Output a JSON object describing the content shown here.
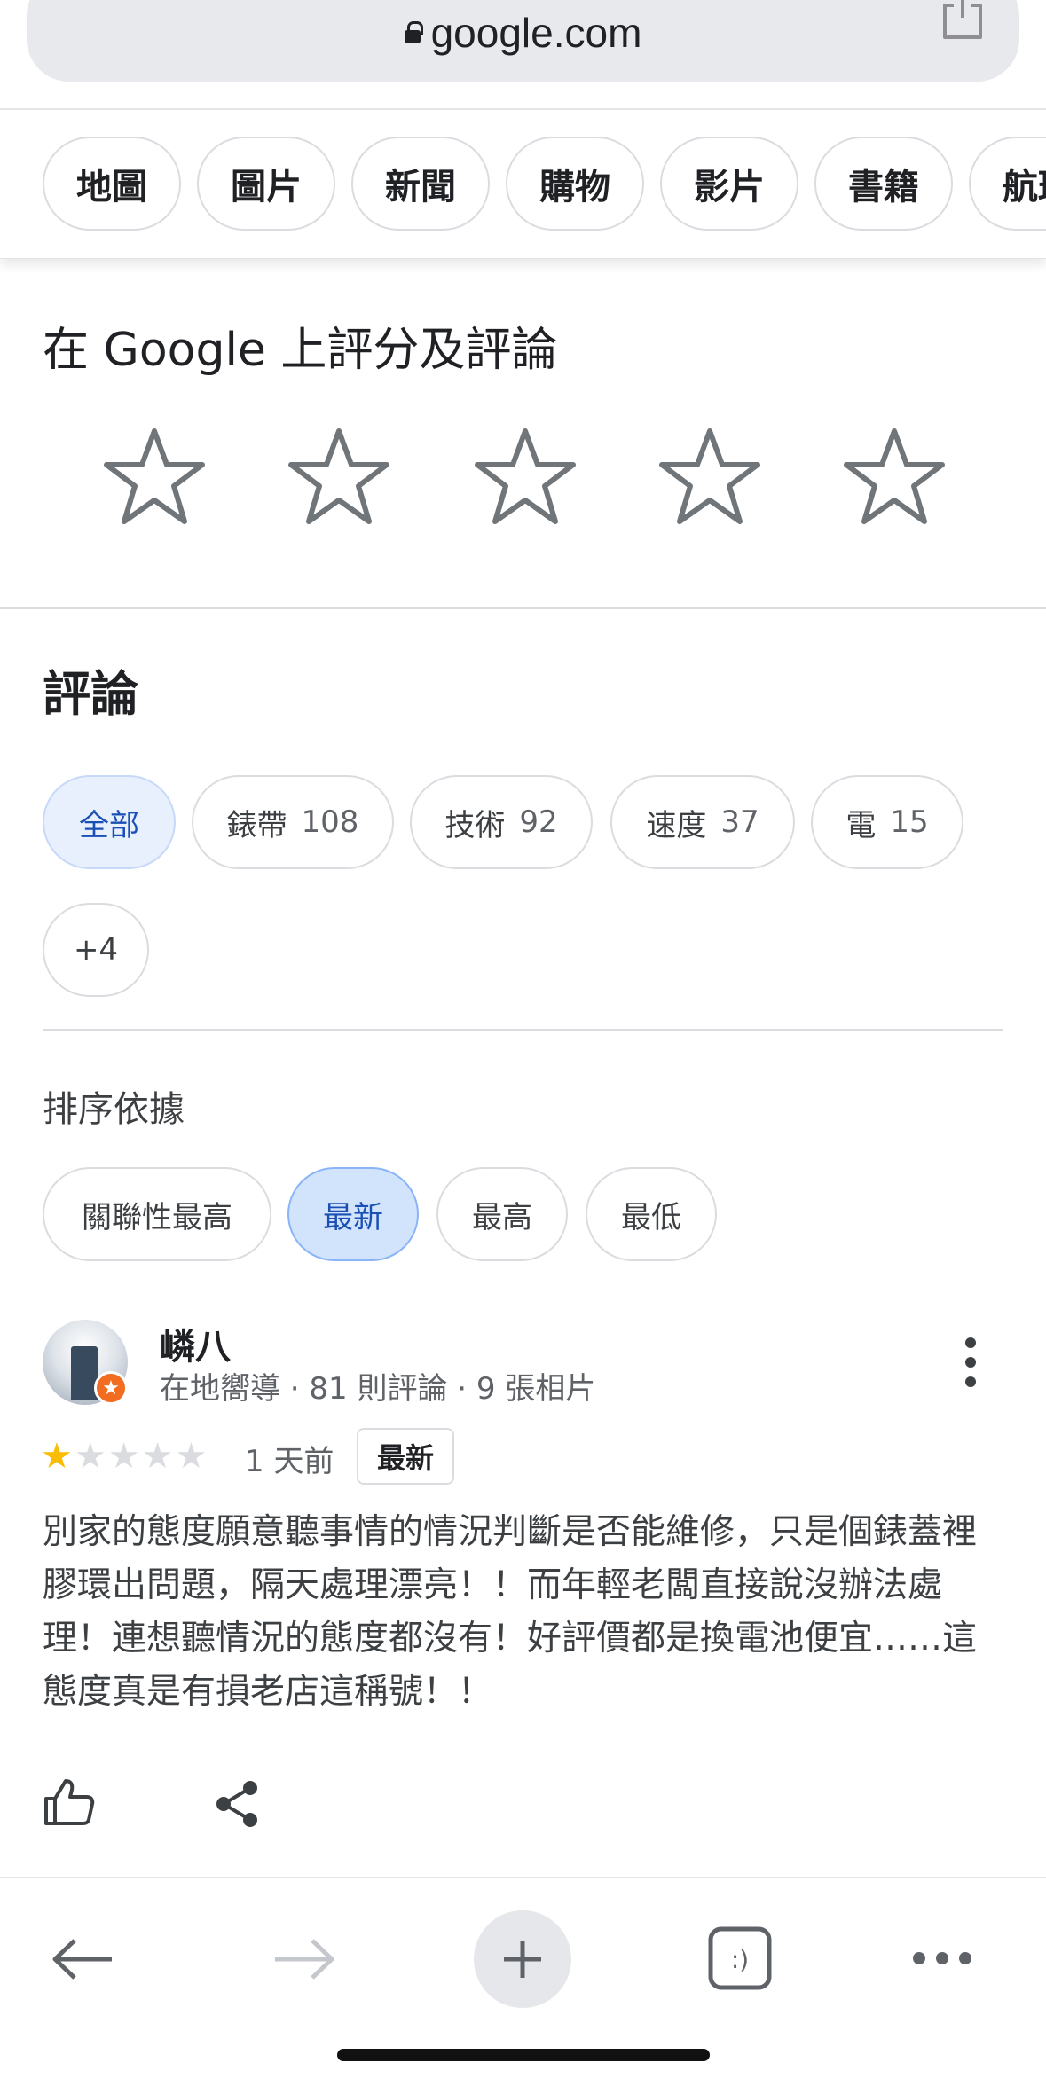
{
  "browser": {
    "url": "google.com"
  },
  "categories": [
    "地圖",
    "圖片",
    "新聞",
    "購物",
    "影片",
    "書籍",
    "航班"
  ],
  "rate_section": {
    "title": "在 Google 上評分及評論",
    "star_count": 5
  },
  "reviews_section": {
    "title": "評論",
    "topics": [
      {
        "label": "全部",
        "count": ""
      },
      {
        "label": "錶帶",
        "count": "108"
      },
      {
        "label": "技術",
        "count": "92"
      },
      {
        "label": "速度",
        "count": "37"
      },
      {
        "label": "電",
        "count": "15"
      },
      {
        "label": "+4",
        "count": ""
      }
    ],
    "selected_topic": "全部",
    "sort_label": "排序依據",
    "sort_options": [
      "關聯性最高",
      "最新",
      "最高",
      "最低"
    ],
    "selected_sort": "最新"
  },
  "review": {
    "reviewer_name": "嶙八",
    "reviewer_meta": "在地嚮導 · 81 則評論 · 9 張相片",
    "rating": 1,
    "max_rating": 5,
    "time_ago": "1 天前",
    "badge": "最新",
    "text": "別家的態度願意聽事情的情況判斷是否能維修，只是個錶蓋裡膠環出問題，隔天處理漂亮！！而年輕老闆直接說沒辦法處理！連想聽情況的態度都沒有！好評價都是換電池便宜……這態度真是有損老店這稱號！！"
  },
  "colors": {
    "accent_blue": "#1a4fb4",
    "star_filled": "#fbbc04",
    "star_empty": "#dadce0"
  }
}
